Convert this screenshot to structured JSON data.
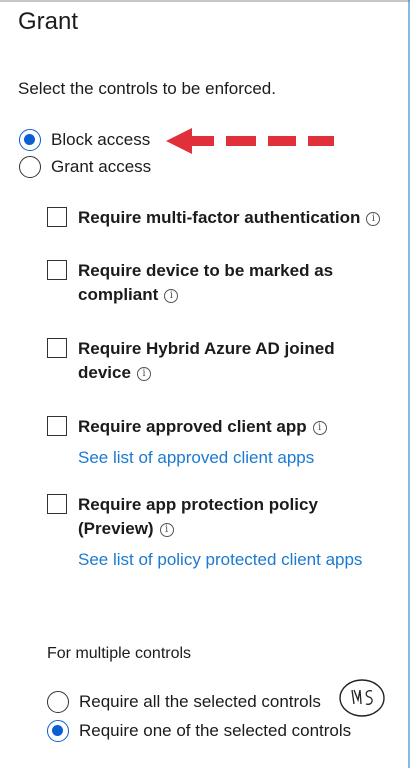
{
  "panel": {
    "title": "Grant",
    "intro": "Select the controls to be enforced."
  },
  "access_options": [
    {
      "label": "Block access",
      "selected": true
    },
    {
      "label": "Grant access",
      "selected": false
    }
  ],
  "controls": [
    {
      "label": "Require multi-factor authentication",
      "checked": false,
      "info_icon": "info-icon"
    },
    {
      "label": "Require device to be marked as compliant",
      "checked": false,
      "info_icon": "info-icon"
    },
    {
      "label": "Require Hybrid Azure AD joined device",
      "checked": false,
      "info_icon": "info-icon"
    },
    {
      "label": "Require approved client app",
      "checked": false,
      "info_icon": "info-icon",
      "link": "See list of approved client apps"
    },
    {
      "label": "Require app protection policy (Preview)",
      "checked": false,
      "info_icon": "info-icon",
      "link": "See list of policy protected client apps"
    }
  ],
  "multiple_controls": {
    "label": "For multiple controls",
    "options": [
      {
        "label": "Require all the selected controls",
        "selected": false
      },
      {
        "label": "Require one of the selected controls",
        "selected": true
      }
    ]
  },
  "colors": {
    "accent": "#0a5fd1",
    "link": "#1b7ad1",
    "annotation_arrow": "#e0303a"
  }
}
